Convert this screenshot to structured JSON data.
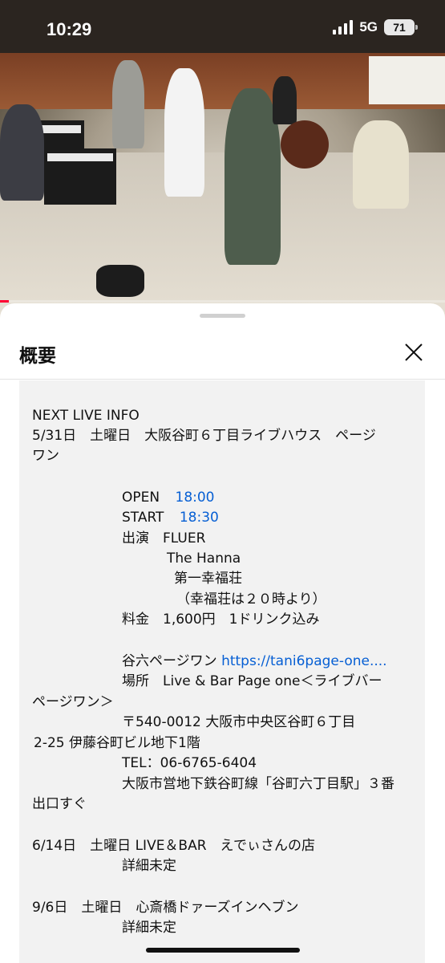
{
  "status": {
    "time": "10:29",
    "network": "5G",
    "battery": "71"
  },
  "video": {
    "progress": 0.02
  },
  "sheet": {
    "title": "概要"
  },
  "description": {
    "cut_line": "・・・・・・・",
    "next_live": "NEXT LIVE INFO",
    "event1_date": "5/31日　土曜日　大阪谷町６丁目ライブハウス　ページ",
    "event1_venue_cont": "ワン",
    "open_label": "OPEN",
    "open_time": "18:00",
    "start_label": "START",
    "start_time": "18:30",
    "performers_label": "出演　FLUER",
    "performer2": "The Hanna",
    "performer3": "第一幸福荘",
    "performer3_note": "（幸福荘は２０時より）",
    "fee": "料金　1,600円　1ドリンク込み",
    "website_label": "谷六ページワン",
    "website_link": "https://tani6page-one....",
    "place_line1": "場所　Live & Bar Page one＜ライブバー",
    "place_line2": "ページワン＞",
    "address_line1": "〒540-0012 大阪市中央区谷町６丁目",
    "address_line2": "2-25 伊藤谷町ビル地下1階",
    "tel": "TEL：06-6765-6404",
    "access_line1": "大阪市営地下鉄谷町線「谷町六丁目駅」３番",
    "access_line2": "出口すぐ",
    "event2_date": "6/14日　土曜日 LIVE＆BAR　えでぃさんの店",
    "event2_detail": "詳細未定",
    "event3_date": "9/6日　土曜日　心斎橋ドァーズインヘブン",
    "event3_detail": "詳細未定"
  },
  "colors": {
    "link": "#065fd4",
    "description_bg": "#f2f2f2",
    "progress": "#ff0033"
  },
  "icons": {
    "close": "close-icon",
    "signal": "signal-icon",
    "battery": "battery-icon"
  }
}
